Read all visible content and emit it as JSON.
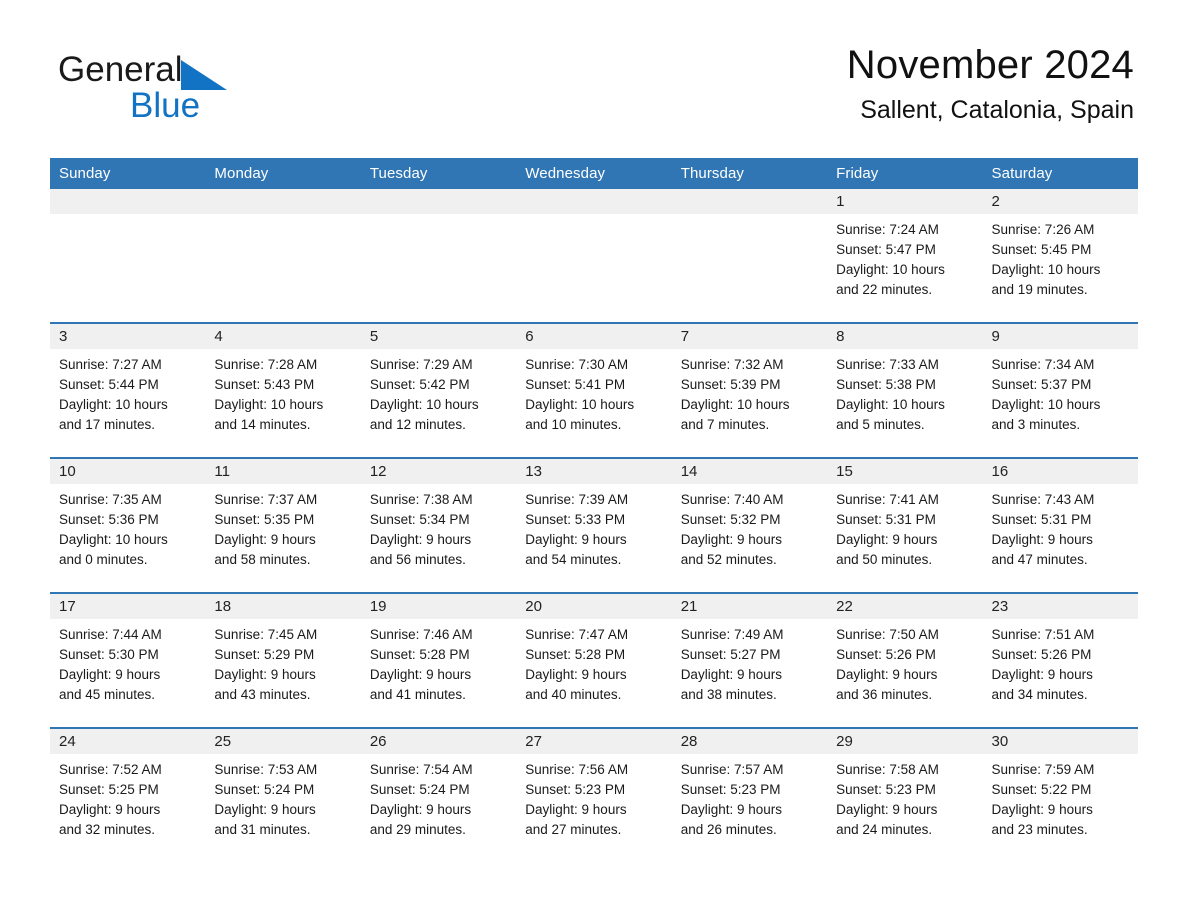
{
  "brand": {
    "name_part1": "General",
    "name_part2": "Blue",
    "triangle_color": "#1273c4"
  },
  "header": {
    "month_title": "November 2024",
    "location": "Sallent, Catalonia, Spain"
  },
  "theme": {
    "header_blue": "#3076b4",
    "band_gray": "#f0f0f0",
    "text_black": "#1a1a1a"
  },
  "weekdays": [
    "Sunday",
    "Monday",
    "Tuesday",
    "Wednesday",
    "Thursday",
    "Friday",
    "Saturday"
  ],
  "weeks": [
    [
      {
        "day": "",
        "sunrise": "",
        "sunset": "",
        "daylight_line1": "",
        "daylight_line2": "",
        "empty": true
      },
      {
        "day": "",
        "sunrise": "",
        "sunset": "",
        "daylight_line1": "",
        "daylight_line2": "",
        "empty": true
      },
      {
        "day": "",
        "sunrise": "",
        "sunset": "",
        "daylight_line1": "",
        "daylight_line2": "",
        "empty": true
      },
      {
        "day": "",
        "sunrise": "",
        "sunset": "",
        "daylight_line1": "",
        "daylight_line2": "",
        "empty": true
      },
      {
        "day": "",
        "sunrise": "",
        "sunset": "",
        "daylight_line1": "",
        "daylight_line2": "",
        "empty": true
      },
      {
        "day": "1",
        "sunrise": "Sunrise: 7:24 AM",
        "sunset": "Sunset: 5:47 PM",
        "daylight_line1": "Daylight: 10 hours",
        "daylight_line2": "and 22 minutes.",
        "empty": false
      },
      {
        "day": "2",
        "sunrise": "Sunrise: 7:26 AM",
        "sunset": "Sunset: 5:45 PM",
        "daylight_line1": "Daylight: 10 hours",
        "daylight_line2": "and 19 minutes.",
        "empty": false
      }
    ],
    [
      {
        "day": "3",
        "sunrise": "Sunrise: 7:27 AM",
        "sunset": "Sunset: 5:44 PM",
        "daylight_line1": "Daylight: 10 hours",
        "daylight_line2": "and 17 minutes.",
        "empty": false
      },
      {
        "day": "4",
        "sunrise": "Sunrise: 7:28 AM",
        "sunset": "Sunset: 5:43 PM",
        "daylight_line1": "Daylight: 10 hours",
        "daylight_line2": "and 14 minutes.",
        "empty": false
      },
      {
        "day": "5",
        "sunrise": "Sunrise: 7:29 AM",
        "sunset": "Sunset: 5:42 PM",
        "daylight_line1": "Daylight: 10 hours",
        "daylight_line2": "and 12 minutes.",
        "empty": false
      },
      {
        "day": "6",
        "sunrise": "Sunrise: 7:30 AM",
        "sunset": "Sunset: 5:41 PM",
        "daylight_line1": "Daylight: 10 hours",
        "daylight_line2": "and 10 minutes.",
        "empty": false
      },
      {
        "day": "7",
        "sunrise": "Sunrise: 7:32 AM",
        "sunset": "Sunset: 5:39 PM",
        "daylight_line1": "Daylight: 10 hours",
        "daylight_line2": "and 7 minutes.",
        "empty": false
      },
      {
        "day": "8",
        "sunrise": "Sunrise: 7:33 AM",
        "sunset": "Sunset: 5:38 PM",
        "daylight_line1": "Daylight: 10 hours",
        "daylight_line2": "and 5 minutes.",
        "empty": false
      },
      {
        "day": "9",
        "sunrise": "Sunrise: 7:34 AM",
        "sunset": "Sunset: 5:37 PM",
        "daylight_line1": "Daylight: 10 hours",
        "daylight_line2": "and 3 minutes.",
        "empty": false
      }
    ],
    [
      {
        "day": "10",
        "sunrise": "Sunrise: 7:35 AM",
        "sunset": "Sunset: 5:36 PM",
        "daylight_line1": "Daylight: 10 hours",
        "daylight_line2": "and 0 minutes.",
        "empty": false
      },
      {
        "day": "11",
        "sunrise": "Sunrise: 7:37 AM",
        "sunset": "Sunset: 5:35 PM",
        "daylight_line1": "Daylight: 9 hours",
        "daylight_line2": "and 58 minutes.",
        "empty": false
      },
      {
        "day": "12",
        "sunrise": "Sunrise: 7:38 AM",
        "sunset": "Sunset: 5:34 PM",
        "daylight_line1": "Daylight: 9 hours",
        "daylight_line2": "and 56 minutes.",
        "empty": false
      },
      {
        "day": "13",
        "sunrise": "Sunrise: 7:39 AM",
        "sunset": "Sunset: 5:33 PM",
        "daylight_line1": "Daylight: 9 hours",
        "daylight_line2": "and 54 minutes.",
        "empty": false
      },
      {
        "day": "14",
        "sunrise": "Sunrise: 7:40 AM",
        "sunset": "Sunset: 5:32 PM",
        "daylight_line1": "Daylight: 9 hours",
        "daylight_line2": "and 52 minutes.",
        "empty": false
      },
      {
        "day": "15",
        "sunrise": "Sunrise: 7:41 AM",
        "sunset": "Sunset: 5:31 PM",
        "daylight_line1": "Daylight: 9 hours",
        "daylight_line2": "and 50 minutes.",
        "empty": false
      },
      {
        "day": "16",
        "sunrise": "Sunrise: 7:43 AM",
        "sunset": "Sunset: 5:31 PM",
        "daylight_line1": "Daylight: 9 hours",
        "daylight_line2": "and 47 minutes.",
        "empty": false
      }
    ],
    [
      {
        "day": "17",
        "sunrise": "Sunrise: 7:44 AM",
        "sunset": "Sunset: 5:30 PM",
        "daylight_line1": "Daylight: 9 hours",
        "daylight_line2": "and 45 minutes.",
        "empty": false
      },
      {
        "day": "18",
        "sunrise": "Sunrise: 7:45 AM",
        "sunset": "Sunset: 5:29 PM",
        "daylight_line1": "Daylight: 9 hours",
        "daylight_line2": "and 43 minutes.",
        "empty": false
      },
      {
        "day": "19",
        "sunrise": "Sunrise: 7:46 AM",
        "sunset": "Sunset: 5:28 PM",
        "daylight_line1": "Daylight: 9 hours",
        "daylight_line2": "and 41 minutes.",
        "empty": false
      },
      {
        "day": "20",
        "sunrise": "Sunrise: 7:47 AM",
        "sunset": "Sunset: 5:28 PM",
        "daylight_line1": "Daylight: 9 hours",
        "daylight_line2": "and 40 minutes.",
        "empty": false
      },
      {
        "day": "21",
        "sunrise": "Sunrise: 7:49 AM",
        "sunset": "Sunset: 5:27 PM",
        "daylight_line1": "Daylight: 9 hours",
        "daylight_line2": "and 38 minutes.",
        "empty": false
      },
      {
        "day": "22",
        "sunrise": "Sunrise: 7:50 AM",
        "sunset": "Sunset: 5:26 PM",
        "daylight_line1": "Daylight: 9 hours",
        "daylight_line2": "and 36 minutes.",
        "empty": false
      },
      {
        "day": "23",
        "sunrise": "Sunrise: 7:51 AM",
        "sunset": "Sunset: 5:26 PM",
        "daylight_line1": "Daylight: 9 hours",
        "daylight_line2": "and 34 minutes.",
        "empty": false
      }
    ],
    [
      {
        "day": "24",
        "sunrise": "Sunrise: 7:52 AM",
        "sunset": "Sunset: 5:25 PM",
        "daylight_line1": "Daylight: 9 hours",
        "daylight_line2": "and 32 minutes.",
        "empty": false
      },
      {
        "day": "25",
        "sunrise": "Sunrise: 7:53 AM",
        "sunset": "Sunset: 5:24 PM",
        "daylight_line1": "Daylight: 9 hours",
        "daylight_line2": "and 31 minutes.",
        "empty": false
      },
      {
        "day": "26",
        "sunrise": "Sunrise: 7:54 AM",
        "sunset": "Sunset: 5:24 PM",
        "daylight_line1": "Daylight: 9 hours",
        "daylight_line2": "and 29 minutes.",
        "empty": false
      },
      {
        "day": "27",
        "sunrise": "Sunrise: 7:56 AM",
        "sunset": "Sunset: 5:23 PM",
        "daylight_line1": "Daylight: 9 hours",
        "daylight_line2": "and 27 minutes.",
        "empty": false
      },
      {
        "day": "28",
        "sunrise": "Sunrise: 7:57 AM",
        "sunset": "Sunset: 5:23 PM",
        "daylight_line1": "Daylight: 9 hours",
        "daylight_line2": "and 26 minutes.",
        "empty": false
      },
      {
        "day": "29",
        "sunrise": "Sunrise: 7:58 AM",
        "sunset": "Sunset: 5:23 PM",
        "daylight_line1": "Daylight: 9 hours",
        "daylight_line2": "and 24 minutes.",
        "empty": false
      },
      {
        "day": "30",
        "sunrise": "Sunrise: 7:59 AM",
        "sunset": "Sunset: 5:22 PM",
        "daylight_line1": "Daylight: 9 hours",
        "daylight_line2": "and 23 minutes.",
        "empty": false
      }
    ]
  ]
}
